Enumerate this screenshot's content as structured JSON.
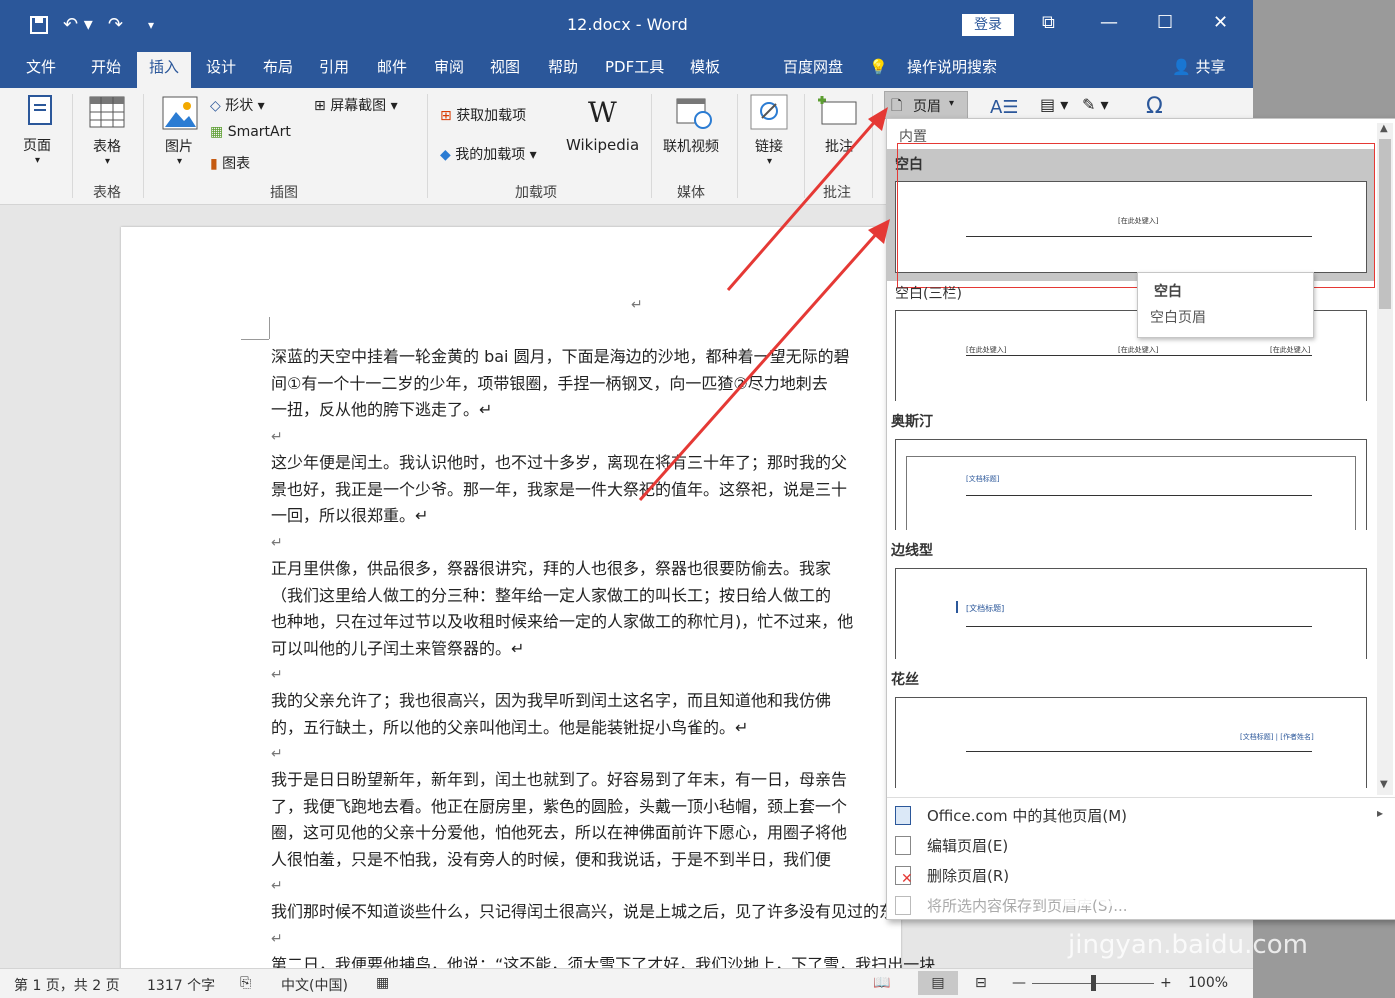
{
  "window": {
    "title": "12.docx  -  Word",
    "login": "登录",
    "qat": {
      "save": "save-icon",
      "undo": "undo-icon",
      "redo": "redo-icon"
    }
  },
  "tabs": [
    "文件",
    "开始",
    "插入",
    "设计",
    "布局",
    "引用",
    "邮件",
    "审阅",
    "视图",
    "帮助",
    "PDF工具",
    "模板",
    "百度网盘",
    "操作说明搜索",
    "共享"
  ],
  "ribbon": {
    "pages": "页面",
    "table": "表格",
    "table_group": "表格",
    "picture": "图片",
    "shapes": "形状",
    "smartart": "SmartArt",
    "chart": "图表",
    "screenshot": "屏幕截图",
    "illustrations_group": "插图",
    "get_addins": "获取加载项",
    "my_addins": "我的加载项",
    "wikipedia": "Wikipedia",
    "addins_group": "加载项",
    "online_video": "联机视频",
    "media_group": "媒体",
    "link": "链接",
    "comment": "批注",
    "comments_group": "批注",
    "header": "页眉"
  },
  "document": {
    "paragraphs": [
      [
        "深蓝的天空中挂着一轮金黄的 bai 圆月，下面是海边的沙地，都种着一望无际的碧",
        "间①有一个十一二岁的少年，项带银圈，手捏一柄钢叉，向一匹猹②尽力地刺去",
        "一扭，反从他的胯下逃走了。↵"
      ],
      [
        "这少年便是闰土。我认识他时，也不过十多岁，离现在将有三十年了；那时我的父",
        "景也好，我正是一个少爷。那一年，我家是一件大祭祀的值年。这祭祀，说是三十",
        "一回，所以很郑重。↵"
      ],
      [
        "正月里供像，供品很多，祭器很讲究，拜的人也很多，祭器也很要防偷去。我家",
        "（我们这里给人做工的分三种：整年给一定人家做工的叫长工；按日给人做工的",
        "也种地，只在过年过节以及收租时候来给一定的人家做工的称忙月)，忙不过来，他",
        "可以叫他的儿子闰土来管祭器的。↵"
      ],
      [
        "我的父亲允许了；我也很高兴，因为我早听到闰土这名字，而且知道他和我仿佛",
        "的，五行缺土，所以他的父亲叫他闰土。他是能装𬭊捉小鸟雀的。↵"
      ],
      [
        "我于是日日盼望新年，新年到，闰土也就到了。好容易到了年末，有一日，母亲告",
        "了，我便飞跑地去看。他正在厨房里，紫色的圆脸，头戴一顶小毡帽，颈上套一个",
        "圈，这可见他的父亲十分爱他，怕他死去，所以在神佛面前许下愿心，用圈子将他",
        "人很怕羞，只是不怕我，没有旁人的时候，便和我说话，于是不到半日，我们便"
      ],
      [
        "我们那时候不知道谈些什么，只记得闰土很高兴，说是上城之后，见了许多没有见过的东西"
      ],
      [
        "第二日，我便要他捕鸟，他说：“这不能，须大雪下了才好，我们沙地上，下了雪，我扫出一块"
      ]
    ]
  },
  "header_gallery": {
    "section_builtin": "内置",
    "items": [
      {
        "name": "空白",
        "placeholders": [
          "[在此处键入]"
        ]
      },
      {
        "name": "空白(三栏)",
        "placeholders": [
          "[在此处键入]",
          "[在此处键入]",
          "[在此处键入]"
        ]
      },
      {
        "name": "奥斯汀",
        "placeholders": [
          "[文档标题]"
        ]
      },
      {
        "name": "边线型",
        "placeholders": [
          "[文档标题]"
        ]
      },
      {
        "name": "花丝",
        "placeholders": [
          "[文档标题] | [作者姓名]"
        ]
      }
    ],
    "tooltip": {
      "title": "空白",
      "desc": "空白页眉"
    },
    "menu": [
      {
        "label": "Office.com 中的其他页眉(M)",
        "icon": "office-icon"
      },
      {
        "label": "编辑页眉(E)",
        "icon": "edit-header-icon"
      },
      {
        "label": "删除页眉(R)",
        "icon": "delete-header-icon"
      },
      {
        "label": "将所选内容保存到页眉库(S)...",
        "icon": "save-selection-icon"
      }
    ]
  },
  "status": {
    "page": "第 1 页，共 2 页",
    "words": "1317 个字",
    "lang": "中文(中国)",
    "zoom": "100%"
  },
  "watermark": {
    "logo": "Baidu经验",
    "url": "jingyan.baidu.com"
  },
  "colors": {
    "brand": "#2b579a",
    "annotation": "#e53935"
  }
}
